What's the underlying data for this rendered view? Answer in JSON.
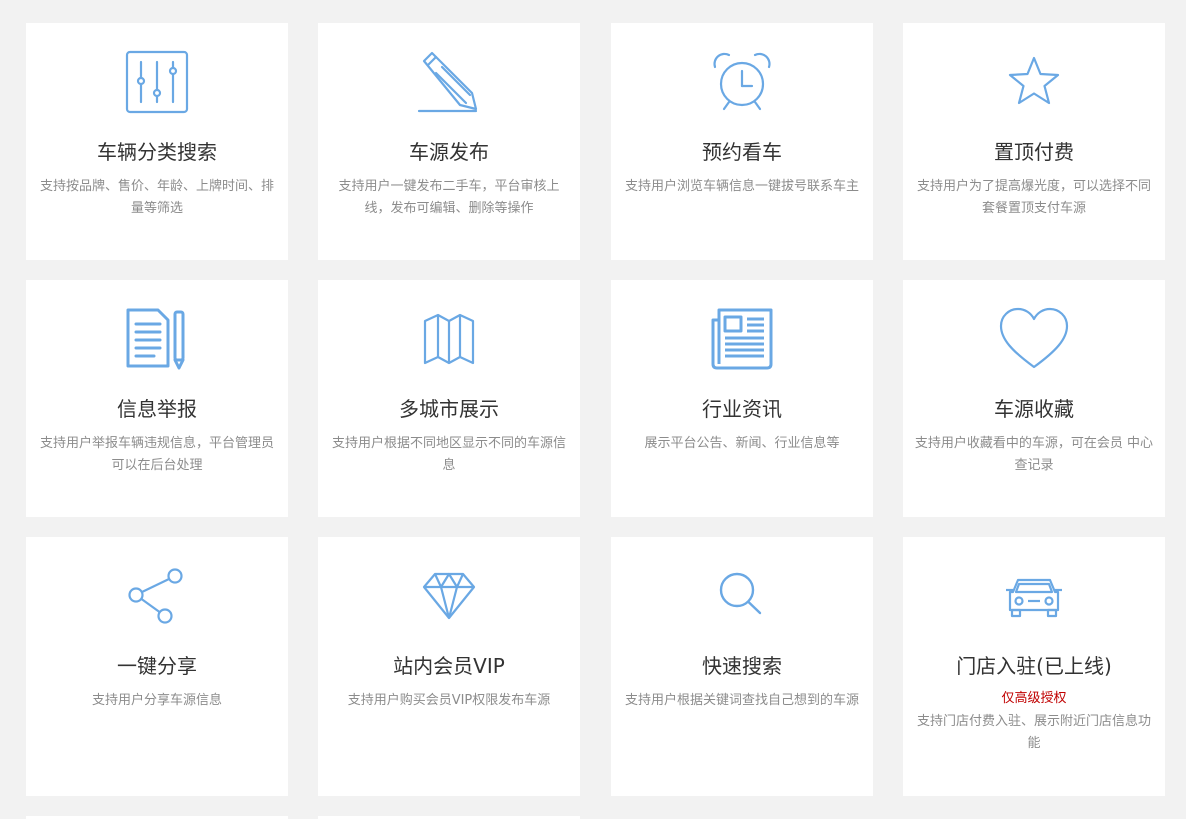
{
  "colors": {
    "background": "#f2f2f2",
    "card": "#ffffff",
    "icon": "#6aa8e4",
    "title": "#333333",
    "desc": "#8c8c8c",
    "note": "#c00000"
  },
  "features": [
    {
      "icon": "sliders-icon",
      "title": "车辆分类搜索",
      "desc": "支持按品牌、售价、年龄、上牌时间、排量等筛选"
    },
    {
      "icon": "pencil-icon",
      "title": "车源发布",
      "desc": "支持用户一键发布二手车，平台审核上线，发布可编辑、删除等操作"
    },
    {
      "icon": "alarm-clock-icon",
      "title": "预约看车",
      "desc": "支持用户浏览车辆信息一键拔号联系车主"
    },
    {
      "icon": "star-icon",
      "title": "置顶付费",
      "desc": "支持用户为了提高爆光度，可以选择不同套餐置顶支付车源"
    },
    {
      "icon": "report-document-icon",
      "title": "信息举报",
      "desc": "支持用户举报车辆违规信息，平台管理员可以在后台处理"
    },
    {
      "icon": "map-icon",
      "title": "多城市展示",
      "desc": "支持用户根据不同地区显示不同的车源信息"
    },
    {
      "icon": "newspaper-icon",
      "title": "行业资讯",
      "desc": "展示平台公告、新闻、行业信息等"
    },
    {
      "icon": "heart-icon",
      "title": "车源收藏",
      "desc": "支持用户收藏看中的车源，可在会员 中心查记录"
    },
    {
      "icon": "share-icon",
      "title": "一键分享",
      "desc": "支持用户分享车源信息"
    },
    {
      "icon": "diamond-icon",
      "title": "站内会员VIP",
      "desc": "支持用户购买会员VIP权限发布车源"
    },
    {
      "icon": "search-icon",
      "title": "快速搜索",
      "desc": "支持用户根据关键词查找自己想到的车源"
    },
    {
      "icon": "car-icon",
      "title": "门店入驻(已上线)",
      "note": "仅高级授权",
      "desc": "支持门店付费入驻、展示附近门店信息功能"
    }
  ]
}
